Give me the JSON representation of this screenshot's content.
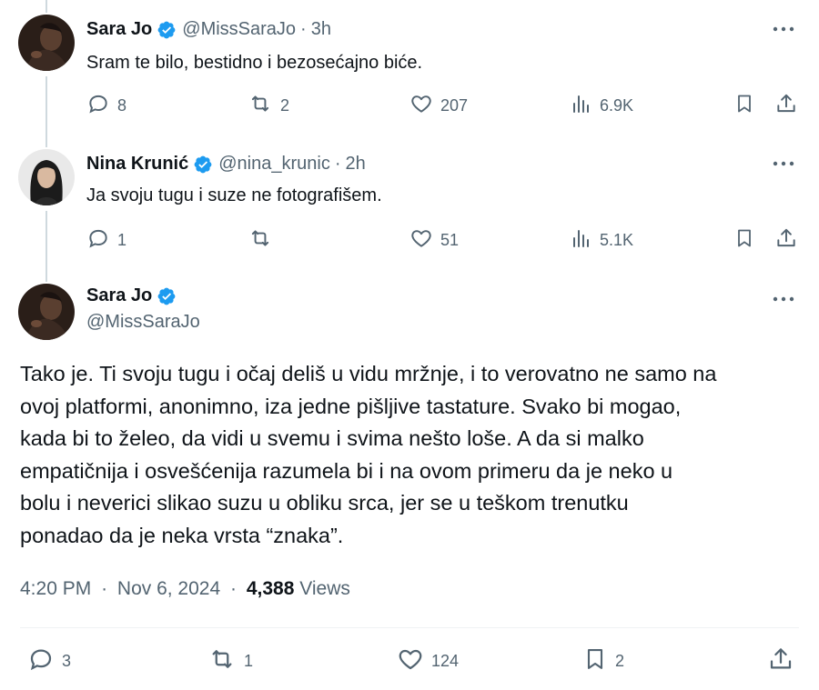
{
  "tweets": [
    {
      "name": "Sara Jo",
      "handle": "@MissSaraJo",
      "time": "3h",
      "text": "Sram te bilo, bestidno i bezosećajno biće.",
      "replies": "8",
      "retweets": "2",
      "likes": "207",
      "views": "6.9K"
    },
    {
      "name": "Nina Krunić",
      "handle": "@nina_krunic",
      "time": "2h",
      "text": "Ja svoju tugu i suze ne fotografišem.",
      "replies": "1",
      "retweets": "",
      "likes": "51",
      "views": "5.1K"
    }
  ],
  "main": {
    "name": "Sara Jo",
    "handle": "@MissSaraJo",
    "text_lines": [
      "Tako je. Ti svoju tugu i očaj deliš u vidu mržnje, i to verovatno ne samo na",
      "ovoj platformi, anonimno, iza jedne pišljive tastature. Svako bi mogao,",
      "kada bi to želeo, da vidi u svemu i svima nešto loše. A da si malko",
      "empatičnija i osvešćenija razumela bi i na ovom primeru da je neko u",
      "bolu i neverici slikao suzu u obliku srca, jer se u teškom trenutku",
      "ponadao da je neka vrsta “znaka”."
    ],
    "time": "4:20 PM",
    "date": "Nov 6, 2024",
    "views_count": "4,388",
    "views_label": "Views",
    "replies": "3",
    "retweets": "1",
    "likes": "124",
    "bookmarks": "2"
  },
  "separator": "·",
  "colors": {
    "verified": "#1d9bf0",
    "muted": "#536471",
    "text": "#0f1419"
  },
  "icons": [
    "more-icon",
    "verified-badge-icon",
    "reply-icon",
    "retweet-icon",
    "like-icon",
    "views-icon",
    "bookmark-icon",
    "share-icon"
  ]
}
